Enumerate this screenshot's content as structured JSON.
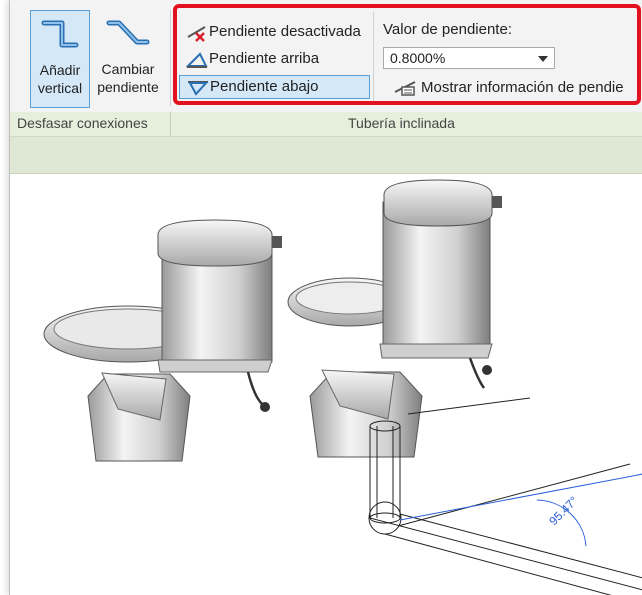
{
  "ribbon": {
    "add_vertical": {
      "line1": "Añadir",
      "line2": "vertical"
    },
    "change_slope": {
      "line1": "Cambiar",
      "line2": "pendiente"
    },
    "slope_off": "Pendiente desactivada",
    "slope_up": "Pendiente arriba",
    "slope_down": "Pendiente abajo",
    "slope_value_label": "Valor de pendiente:",
    "slope_value": "0.8000%",
    "show_info": "Mostrar información de pendie"
  },
  "panels": {
    "offset_connections": "Desfasar conexiones",
    "sloped_pipe": "Tubería inclinada"
  },
  "viewport": {
    "angle_label": "95.47°"
  },
  "colors": {
    "highlight_border": "#e3111f",
    "active_fill": "#d5e8f8",
    "active_border": "#5a9fd6",
    "dimension_blue": "#2b5fd9",
    "panel_green": "#e6efdc"
  }
}
